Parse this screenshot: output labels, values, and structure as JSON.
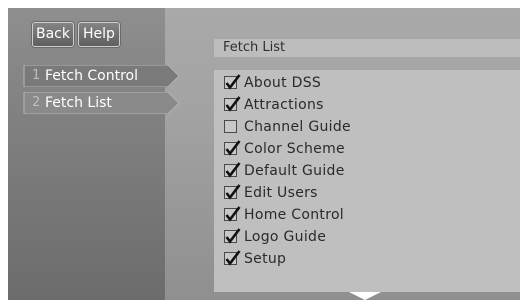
{
  "toolbar": {
    "back_label": "Back",
    "help_label": "Help"
  },
  "nav": [
    {
      "number": "1",
      "label": "Fetch Control"
    },
    {
      "number": "2",
      "label": "Fetch List"
    }
  ],
  "list": {
    "title": "Fetch List",
    "items": [
      {
        "label": "About DSS",
        "checked": true
      },
      {
        "label": "Attractions",
        "checked": true
      },
      {
        "label": "Channel Guide",
        "checked": false
      },
      {
        "label": "Color Scheme",
        "checked": true
      },
      {
        "label": "Default Guide",
        "checked": true
      },
      {
        "label": "Edit Users",
        "checked": true
      },
      {
        "label": "Home Control",
        "checked": true
      },
      {
        "label": "Logo Guide",
        "checked": true
      },
      {
        "label": "Setup",
        "checked": true
      }
    ]
  },
  "icons": {
    "scroll_down": "down-triangle-icon",
    "checkmark": "checkmark-icon"
  },
  "colors": {
    "check_mark": "#111111",
    "panel": "#bfbfbf",
    "sidebar": "#7a7a7a"
  }
}
